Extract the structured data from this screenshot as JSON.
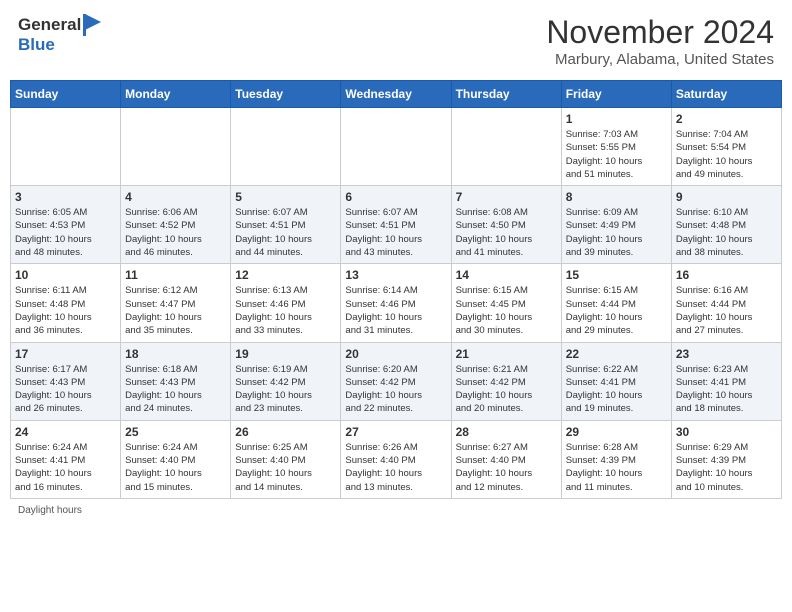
{
  "header": {
    "logo_general": "General",
    "logo_blue": "Blue",
    "month_title": "November 2024",
    "location": "Marbury, Alabama, United States"
  },
  "calendar": {
    "weekdays": [
      "Sunday",
      "Monday",
      "Tuesday",
      "Wednesday",
      "Thursday",
      "Friday",
      "Saturday"
    ],
    "weeks": [
      [
        {
          "day": "",
          "info": ""
        },
        {
          "day": "",
          "info": ""
        },
        {
          "day": "",
          "info": ""
        },
        {
          "day": "",
          "info": ""
        },
        {
          "day": "",
          "info": ""
        },
        {
          "day": "1",
          "info": "Sunrise: 7:03 AM\nSunset: 5:55 PM\nDaylight: 10 hours\nand 51 minutes."
        },
        {
          "day": "2",
          "info": "Sunrise: 7:04 AM\nSunset: 5:54 PM\nDaylight: 10 hours\nand 49 minutes."
        }
      ],
      [
        {
          "day": "3",
          "info": "Sunrise: 6:05 AM\nSunset: 4:53 PM\nDaylight: 10 hours\nand 48 minutes."
        },
        {
          "day": "4",
          "info": "Sunrise: 6:06 AM\nSunset: 4:52 PM\nDaylight: 10 hours\nand 46 minutes."
        },
        {
          "day": "5",
          "info": "Sunrise: 6:07 AM\nSunset: 4:51 PM\nDaylight: 10 hours\nand 44 minutes."
        },
        {
          "day": "6",
          "info": "Sunrise: 6:07 AM\nSunset: 4:51 PM\nDaylight: 10 hours\nand 43 minutes."
        },
        {
          "day": "7",
          "info": "Sunrise: 6:08 AM\nSunset: 4:50 PM\nDaylight: 10 hours\nand 41 minutes."
        },
        {
          "day": "8",
          "info": "Sunrise: 6:09 AM\nSunset: 4:49 PM\nDaylight: 10 hours\nand 39 minutes."
        },
        {
          "day": "9",
          "info": "Sunrise: 6:10 AM\nSunset: 4:48 PM\nDaylight: 10 hours\nand 38 minutes."
        }
      ],
      [
        {
          "day": "10",
          "info": "Sunrise: 6:11 AM\nSunset: 4:48 PM\nDaylight: 10 hours\nand 36 minutes."
        },
        {
          "day": "11",
          "info": "Sunrise: 6:12 AM\nSunset: 4:47 PM\nDaylight: 10 hours\nand 35 minutes."
        },
        {
          "day": "12",
          "info": "Sunrise: 6:13 AM\nSunset: 4:46 PM\nDaylight: 10 hours\nand 33 minutes."
        },
        {
          "day": "13",
          "info": "Sunrise: 6:14 AM\nSunset: 4:46 PM\nDaylight: 10 hours\nand 31 minutes."
        },
        {
          "day": "14",
          "info": "Sunrise: 6:15 AM\nSunset: 4:45 PM\nDaylight: 10 hours\nand 30 minutes."
        },
        {
          "day": "15",
          "info": "Sunrise: 6:15 AM\nSunset: 4:44 PM\nDaylight: 10 hours\nand 29 minutes."
        },
        {
          "day": "16",
          "info": "Sunrise: 6:16 AM\nSunset: 4:44 PM\nDaylight: 10 hours\nand 27 minutes."
        }
      ],
      [
        {
          "day": "17",
          "info": "Sunrise: 6:17 AM\nSunset: 4:43 PM\nDaylight: 10 hours\nand 26 minutes."
        },
        {
          "day": "18",
          "info": "Sunrise: 6:18 AM\nSunset: 4:43 PM\nDaylight: 10 hours\nand 24 minutes."
        },
        {
          "day": "19",
          "info": "Sunrise: 6:19 AM\nSunset: 4:42 PM\nDaylight: 10 hours\nand 23 minutes."
        },
        {
          "day": "20",
          "info": "Sunrise: 6:20 AM\nSunset: 4:42 PM\nDaylight: 10 hours\nand 22 minutes."
        },
        {
          "day": "21",
          "info": "Sunrise: 6:21 AM\nSunset: 4:42 PM\nDaylight: 10 hours\nand 20 minutes."
        },
        {
          "day": "22",
          "info": "Sunrise: 6:22 AM\nSunset: 4:41 PM\nDaylight: 10 hours\nand 19 minutes."
        },
        {
          "day": "23",
          "info": "Sunrise: 6:23 AM\nSunset: 4:41 PM\nDaylight: 10 hours\nand 18 minutes."
        }
      ],
      [
        {
          "day": "24",
          "info": "Sunrise: 6:24 AM\nSunset: 4:41 PM\nDaylight: 10 hours\nand 16 minutes."
        },
        {
          "day": "25",
          "info": "Sunrise: 6:24 AM\nSunset: 4:40 PM\nDaylight: 10 hours\nand 15 minutes."
        },
        {
          "day": "26",
          "info": "Sunrise: 6:25 AM\nSunset: 4:40 PM\nDaylight: 10 hours\nand 14 minutes."
        },
        {
          "day": "27",
          "info": "Sunrise: 6:26 AM\nSunset: 4:40 PM\nDaylight: 10 hours\nand 13 minutes."
        },
        {
          "day": "28",
          "info": "Sunrise: 6:27 AM\nSunset: 4:40 PM\nDaylight: 10 hours\nand 12 minutes."
        },
        {
          "day": "29",
          "info": "Sunrise: 6:28 AM\nSunset: 4:39 PM\nDaylight: 10 hours\nand 11 minutes."
        },
        {
          "day": "30",
          "info": "Sunrise: 6:29 AM\nSunset: 4:39 PM\nDaylight: 10 hours\nand 10 minutes."
        }
      ]
    ]
  },
  "footer": {
    "daylight_label": "Daylight hours"
  }
}
